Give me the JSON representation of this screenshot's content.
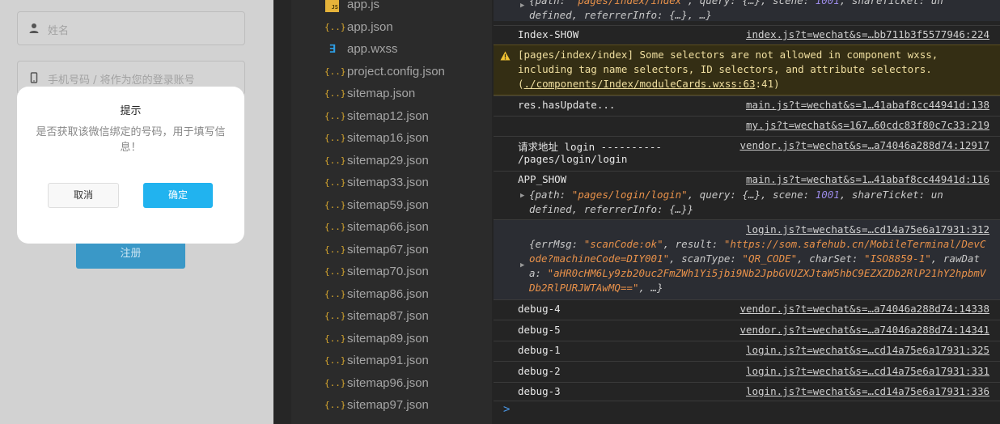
{
  "simulator": {
    "name_placeholder": "姓名",
    "phone_placeholder": "手机号码 / 将作为您的登录账号",
    "register_label": "注册",
    "modal": {
      "title": "提示",
      "content": "是否获取该微信绑定的号码，用于填写信息！",
      "cancel_label": "取消",
      "confirm_label": "确定"
    }
  },
  "file_tree": {
    "items": [
      {
        "name": "app.js",
        "icon": "js-icon"
      },
      {
        "name": "app.json",
        "icon": "json-icon"
      },
      {
        "name": "app.wxss",
        "icon": "css-icon"
      },
      {
        "name": "project.config.json",
        "icon": "json-icon"
      },
      {
        "name": "sitemap.json",
        "icon": "json-icon"
      },
      {
        "name": "sitemap12.json",
        "icon": "json-icon"
      },
      {
        "name": "sitemap16.json",
        "icon": "json-icon"
      },
      {
        "name": "sitemap29.json",
        "icon": "json-icon"
      },
      {
        "name": "sitemap33.json",
        "icon": "json-icon"
      },
      {
        "name": "sitemap59.json",
        "icon": "json-icon"
      },
      {
        "name": "sitemap66.json",
        "icon": "json-icon"
      },
      {
        "name": "sitemap67.json",
        "icon": "json-icon"
      },
      {
        "name": "sitemap70.json",
        "icon": "json-icon"
      },
      {
        "name": "sitemap86.json",
        "icon": "json-icon"
      },
      {
        "name": "sitemap87.json",
        "icon": "json-icon"
      },
      {
        "name": "sitemap89.json",
        "icon": "json-icon"
      },
      {
        "name": "sitemap91.json",
        "icon": "json-icon"
      },
      {
        "name": "sitemap96.json",
        "icon": "json-icon"
      },
      {
        "name": "sitemap97.json",
        "icon": "json-icon"
      }
    ]
  },
  "console": {
    "top_partial": "{path: \"pages/index/index\", query: {…}, scene: 1001, shareTicket: undefined, referrerInfo: {…}, …}",
    "logs": [
      {
        "msg": "Index-SHOW",
        "src": "index.js?t=wechat&s=…bb711b3f5577946:224"
      },
      {
        "msg": "[pages/index/index] Some selectors are not allowed in component wxss, including tag name selectors, ID selectors, and attribute selectors.",
        "link": "./components/Index/moduleCards.wxss:63",
        "link_suffix": ":41)"
      },
      {
        "msg": "res.hasUpdate...",
        "src": "main.js?t=wechat&s=1…41abaf8cc44941d:138"
      },
      {
        "msg": "",
        "src": "my.js?t=wechat&s=167…60cdc83f80c7c33:219"
      },
      {
        "msg": "请求地址 login ----------",
        "msg2": "/pages/login/login",
        "src": "vendor.js?t=wechat&s=…a74046a288d74:12917"
      },
      {
        "msg": "APP_SHOW",
        "src": "main.js?t=wechat&s=1…41abaf8cc44941d:116",
        "obj_path": "pages/login/login",
        "obj_scene": "1001"
      },
      {
        "msg": "",
        "src": "login.js?t=wechat&s=…cd14a75e6a17931:312",
        "errMsg": "scanCode:ok",
        "result": "https://som.safehub.cn/MobileTerminal/DevCode?machineCode=DIY001",
        "scanType": "QR_CODE",
        "charSet": "ISO8859-1",
        "rawData": "aHR0cHM6Ly9zb20uc2FmZWh1Yi5jbi9Nb2JpbGVUZXJtaW5hbC9EZXZDb2RlP21hY2hpbmVDb2RlPURJWTAwMQ=="
      },
      {
        "msg": "debug-4",
        "src": "vendor.js?t=wechat&s=…a74046a288d74:14338"
      },
      {
        "msg": "debug-5",
        "src": "vendor.js?t=wechat&s=…a74046a288d74:14341"
      },
      {
        "msg": "debug-1",
        "src": "login.js?t=wechat&s=…cd14a75e6a17931:325"
      },
      {
        "msg": "debug-2",
        "src": "login.js?t=wechat&s=…cd14a75e6a17931:331"
      },
      {
        "msg": "debug-3",
        "src": "login.js?t=wechat&s=…cd14a75e6a17931:336"
      }
    ],
    "prompt": ">"
  },
  "colors": {
    "accent_confirm": "#21b3ef",
    "register_button": "#3a98c7",
    "warning_bg": "#342e14",
    "string_value": "#e8914a",
    "number_value": "#9b8ae8"
  }
}
